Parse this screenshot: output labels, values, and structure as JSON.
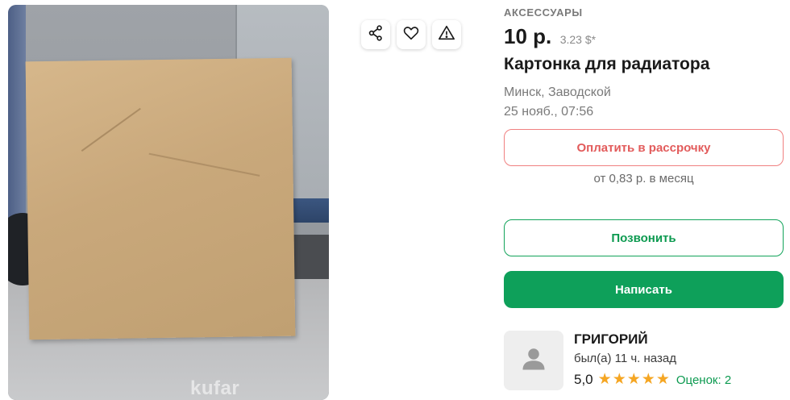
{
  "photo": {
    "watermark": "kufar"
  },
  "actions": {
    "share_icon": "share-icon",
    "favorite_icon": "heart-icon",
    "report_icon": "warning-icon"
  },
  "listing": {
    "category": "АКСЕССУАРЫ",
    "price": "10 р.",
    "price_usd": "3.23 $*",
    "title": "Картонка для радиатора",
    "location": "Минск, Заводской",
    "date": "25 нояб., 07:56"
  },
  "buttons": {
    "installment": "Оплатить в рассрочку",
    "installment_note": "от 0,83 р. в месяц",
    "call": "Позвонить",
    "write": "Написать"
  },
  "seller": {
    "name": "ГРИГОРИЙ",
    "last_seen": "был(а) 11 ч. назад",
    "rating": "5,0",
    "stars": 5,
    "reviews": "Оценок: 2"
  },
  "colors": {
    "accent_green": "#0ea05a",
    "installment_red": "#e25b5b",
    "star_color": "#f5a623"
  }
}
